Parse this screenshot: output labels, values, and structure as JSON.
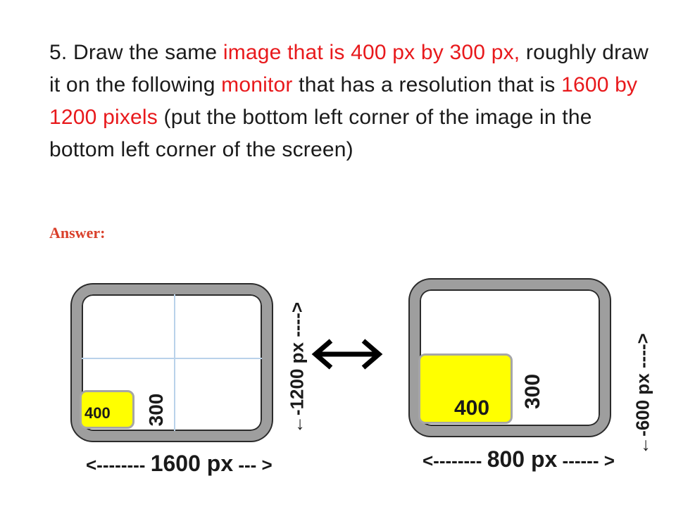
{
  "question": {
    "number": "5.",
    "part1": "Draw the same",
    "highlight1": "image that is 400 px by 300 px,",
    "part2": "roughly draw it on the following",
    "highlight2": "monitor",
    "part3": "that has a resolution that is",
    "highlight3": "1600 by 1200 pixels",
    "part4": "(put the bottom left corner of the image in the bottom left corner of the screen)"
  },
  "answer_label": "Answer:",
  "monitor_1600": {
    "image_width_label": "400",
    "image_height_label": "300",
    "width_arrow_left": "<--------",
    "width_value": "1600 px",
    "width_arrow_right": "--- >",
    "height_arrow_left": "←-",
    "height_value": "1200 px",
    "height_arrow_right": "---->"
  },
  "monitor_800": {
    "image_width_label": "400",
    "image_height_label": "300",
    "width_arrow_left": "<--------",
    "width_value": "800 px",
    "width_arrow_right": "------ >",
    "height_arrow_left": "←-",
    "height_value": "600 px",
    "height_arrow_right": "---->"
  },
  "colors": {
    "highlight": "#e8191c",
    "answer": "#d93f2a",
    "image_fill": "#ffff00",
    "monitor_bezel": "#9e9e9e",
    "gridline": "#b9d2ea"
  },
  "icons": {
    "comparison_arrow": "double-arrow-icon"
  }
}
